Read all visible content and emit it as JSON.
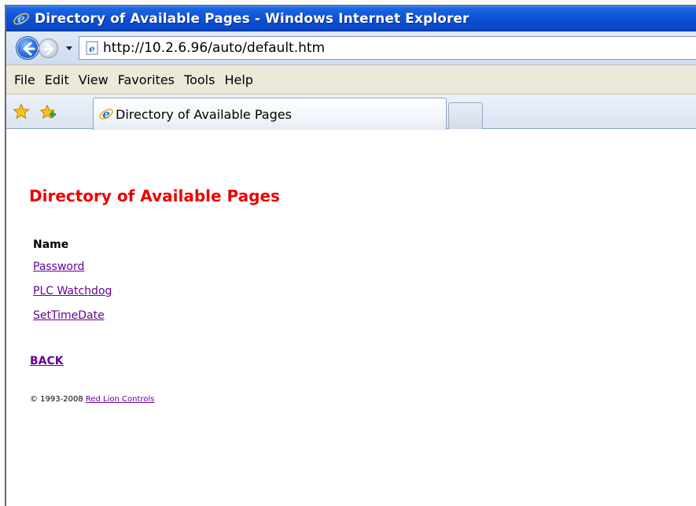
{
  "window": {
    "title": "Directory of Available Pages - Windows Internet Explorer"
  },
  "address_bar": {
    "url": "http://10.2.6.96/auto/default.htm"
  },
  "menu": {
    "items": [
      "File",
      "Edit",
      "View",
      "Favorites",
      "Tools",
      "Help"
    ]
  },
  "tabs": {
    "active_label": "Directory of Available Pages"
  },
  "page": {
    "heading": "Directory of Available Pages",
    "column_header": "Name",
    "links": [
      "Password",
      "PLC Watchdog",
      "SetTimeDate"
    ],
    "back_label": "BACK",
    "footer_prefix": "© 1993-2008 ",
    "footer_link": "Red Lion Controls"
  },
  "colors": {
    "heading": "#ee0000",
    "link": "#660099",
    "titlebar": "#0a4fd6"
  }
}
